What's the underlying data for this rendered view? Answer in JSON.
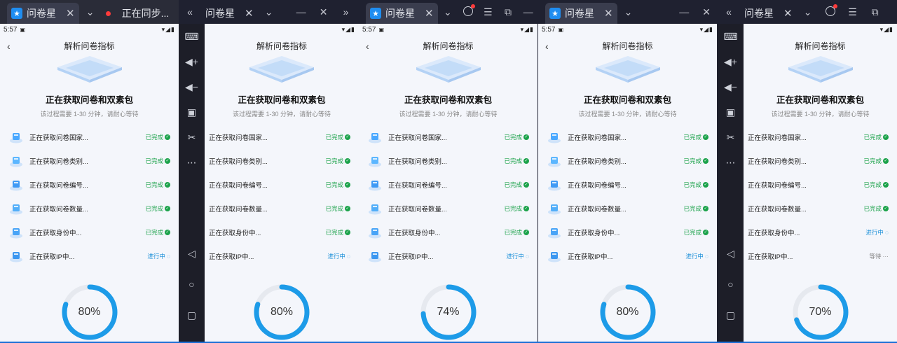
{
  "tabs": {
    "b1": {
      "app_title": "问卷星",
      "second_tab": "正在同步..."
    },
    "b2": {
      "app_title": "问卷星"
    },
    "b3": {
      "app_title": "问卷星"
    },
    "b4": {
      "app_title": "问卷星"
    },
    "b5": {
      "app_title": "问卷星"
    }
  },
  "panels": [
    {
      "time": "5:57",
      "title": "解析问卷指标",
      "heading": "正在获取问卷和双素包",
      "subtitle": "该过程需要 1-30 分钟，请耐心等待",
      "percent": "80%",
      "progress": 0.8,
      "show_icons": true,
      "show_time": true,
      "rows": [
        {
          "label": "正在获取问卷国家...",
          "status": "已完成",
          "state": "done"
        },
        {
          "label": "正在获取问卷类别...",
          "status": "已完成",
          "state": "done"
        },
        {
          "label": "正在获取问卷编号...",
          "status": "已完成",
          "state": "done"
        },
        {
          "label": "正在获取问卷数量...",
          "status": "已完成",
          "state": "done"
        },
        {
          "label": "正在获取身份中...",
          "status": "已完成",
          "state": "done"
        },
        {
          "label": "正在获取IP中...",
          "status": "进行中",
          "state": "run"
        }
      ]
    },
    {
      "time": "",
      "title": "解析问卷指标",
      "heading": "正在获取问卷和双素包",
      "subtitle": "该过程需要 1-30 分钟，请耐心等待",
      "percent": "80%",
      "progress": 0.8,
      "show_icons": false,
      "show_time": false,
      "rows": [
        {
          "label": "正在获取问卷国家...",
          "status": "已完成",
          "state": "done"
        },
        {
          "label": "正在获取问卷类别...",
          "status": "已完成",
          "state": "done"
        },
        {
          "label": "正在获取问卷编号...",
          "status": "已完成",
          "state": "done"
        },
        {
          "label": "正在获取问卷数量...",
          "status": "已完成",
          "state": "done"
        },
        {
          "label": "正在获取身份中...",
          "status": "已完成",
          "state": "done"
        },
        {
          "label": "正在获取IP中...",
          "status": "进行中",
          "state": "run"
        }
      ]
    },
    {
      "time": "5:57",
      "title": "解析问卷指标",
      "heading": "正在获取问卷和双素包",
      "subtitle": "该过程需要 1-30 分钟，请耐心等待",
      "percent": "74%",
      "progress": 0.74,
      "show_icons": true,
      "show_time": true,
      "rows": [
        {
          "label": "正在获取问卷国家...",
          "status": "已完成",
          "state": "done"
        },
        {
          "label": "正在获取问卷类别...",
          "status": "已完成",
          "state": "done"
        },
        {
          "label": "正在获取问卷编号...",
          "status": "已完成",
          "state": "done"
        },
        {
          "label": "正在获取问卷数量...",
          "status": "已完成",
          "state": "done"
        },
        {
          "label": "正在获取身份中...",
          "status": "已完成",
          "state": "done"
        },
        {
          "label": "正在获取IP中...",
          "status": "进行中",
          "state": "run"
        }
      ]
    },
    {
      "time": "5:57",
      "title": "解析问卷指标",
      "heading": "正在获取问卷和双素包",
      "subtitle": "该过程需要 1-30 分钟，请耐心等待",
      "percent": "80%",
      "progress": 0.8,
      "show_icons": true,
      "show_time": true,
      "rows": [
        {
          "label": "正在获取问卷国家...",
          "status": "已完成",
          "state": "done"
        },
        {
          "label": "正在获取问卷类别...",
          "status": "已完成",
          "state": "done"
        },
        {
          "label": "正在获取问卷编号...",
          "status": "已完成",
          "state": "done"
        },
        {
          "label": "正在获取问卷数量...",
          "status": "已完成",
          "state": "done"
        },
        {
          "label": "正在获取身份中...",
          "status": "已完成",
          "state": "done"
        },
        {
          "label": "正在获取IP中...",
          "status": "进行中",
          "state": "run"
        }
      ]
    },
    {
      "time": "",
      "title": "解析问卷指标",
      "heading": "正在获取问卷和双素包",
      "subtitle": "该过程需要 1-30 分钟，请耐心等待",
      "percent": "70%",
      "progress": 0.7,
      "show_icons": false,
      "show_time": false,
      "rows": [
        {
          "label": "正在获取问卷国家...",
          "status": "已完成",
          "state": "done"
        },
        {
          "label": "正在获取问卷类别...",
          "status": "已完成",
          "state": "done"
        },
        {
          "label": "正在获取问卷编号...",
          "status": "已完成",
          "state": "done"
        },
        {
          "label": "正在获取问卷数量...",
          "status": "已完成",
          "state": "done"
        },
        {
          "label": "正在获取身份中...",
          "status": "进行中",
          "state": "run"
        },
        {
          "label": "正在获取IP中...",
          "status": "等待",
          "state": "wait"
        }
      ]
    }
  ],
  "colors": {
    "accent": "#1a8fd8",
    "done": "#1ba24a",
    "ring_track": "#e6e9ef",
    "ring_fill": "#1d9be8"
  }
}
